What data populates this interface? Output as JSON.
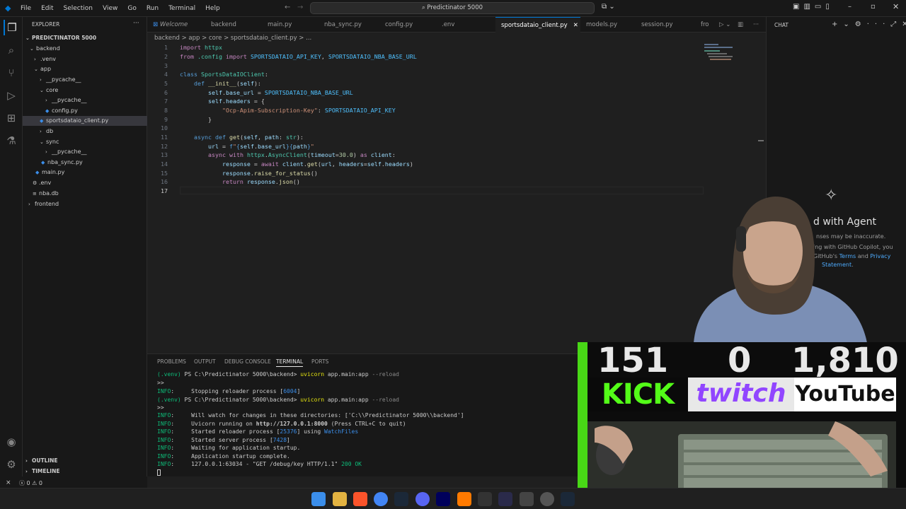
{
  "menu": [
    "File",
    "Edit",
    "Selection",
    "View",
    "Go",
    "Run",
    "Terminal",
    "Help"
  ],
  "command_center": "Predictinator 5000",
  "explorer": {
    "title": "EXPLORER",
    "root": "PREDICTINATOR 5000",
    "items": [
      "backend",
      ".venv",
      "app",
      "__pycache__",
      "core",
      "__pycache__",
      "config.py",
      "sportsdataio_client.py",
      "db",
      "sync",
      "__pycache__",
      "nba_sync.py",
      "main.py",
      ".env",
      "nba.db",
      "frontend"
    ],
    "outline": "OUTLINE",
    "timeline": "TIMELINE"
  },
  "tabs": [
    "Welcome",
    "backend",
    "main.py",
    "nba_sync.py",
    "config.py",
    ".env",
    "sportsdataio_client.py",
    "models.py",
    "session.py",
    "fro"
  ],
  "breadcrumb": "backend > app > core > sportsdataio_client.py > ...",
  "code_lines": [
    "1",
    "2",
    "3",
    "4",
    "5",
    "6",
    "7",
    "8",
    "9",
    "10",
    "11",
    "12",
    "13",
    "14",
    "15",
    "16",
    "17"
  ],
  "panel": {
    "tabs": [
      "PROBLEMS",
      "OUTPUT",
      "DEBUG CONSOLE",
      "TERMINAL",
      "PORTS"
    ],
    "lines": [
      "(.venv) PS C:\\Predictinator 5000\\backend> uvicorn app.main:app --reload",
      ">>",
      "INFO:     Stopping reloader process [6004]",
      "(.venv) PS C:\\Predictinator 5000\\backend> uvicorn app.main:app --reload",
      ">>",
      "INFO:     Will watch for changes in these directories: ['C:\\\\Predictinator 5000\\\\backend']",
      "INFO:     Uvicorn running on http://127.0.0.1:8000 (Press CTRL+C to quit)",
      "INFO:     Started reloader process [25376] using WatchFiles",
      "INFO:     Started server process [7428]",
      "INFO:     Waiting for application startup.",
      "INFO:     Application startup complete.",
      "INFO:     127.0.0.1:63034 - \"GET /debug/key HTTP/1.1\" 200 OK"
    ]
  },
  "chat": {
    "title": "CHAT",
    "heading": "d with Agent",
    "line1": "nses may be inaccurate.",
    "line2": "ing with GitHub Copilot, you",
    "line3_a": "GitHub's ",
    "terms": "Terms",
    "and": " and ",
    "privacy": "Privacy",
    "statement": "Statement",
    "period": "."
  },
  "status": {
    "errors": "0",
    "warnings": "0"
  },
  "stream_overlay": {
    "kick_count": "151",
    "twitch_count": "0",
    "youtube_count": "1,810",
    "kick_label": "KICK",
    "twitch_label": "twitch",
    "youtube_label": "YouTube"
  },
  "colors": {
    "accent": "#0078d4",
    "kick": "#53fc18",
    "twitch": "#9146ff",
    "youtube": "#ff0000"
  }
}
